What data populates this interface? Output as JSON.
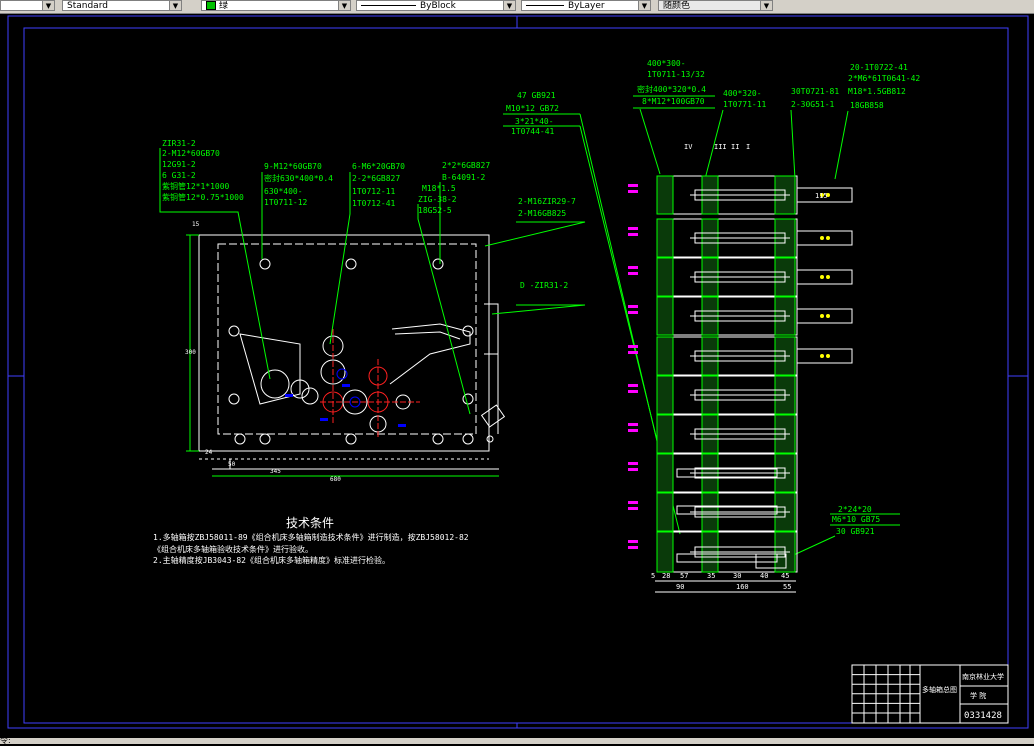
{
  "toolbar": {
    "textstyle": "Standard",
    "color": "绿",
    "linetype": "ByBlock",
    "lineweight": "ByLayer",
    "plotstyle": "随颜色"
  },
  "drawing": {
    "left_callouts": [
      "ZIR31-2",
      "2-M12*60GB70",
      "12G91-2",
      "6 G31-2",
      "紫铜管12*1*1000",
      "紫铜管12*0.75*1000"
    ],
    "mid_callouts_a": [
      "9-M12*60GB70",
      "密封630*400*0.4",
      "630*400-",
      "1T0711-12"
    ],
    "mid_callouts_b": [
      "6-M6*20GB70",
      "2-2*6GB827",
      "1T0712-11",
      "1T0712-41"
    ],
    "mid_callouts_c": [
      "2*2*6GB827",
      "B-64091-2"
    ],
    "mid_callouts_d": [
      "M18*1.5",
      "ZIG-38-2",
      "18G52-5"
    ],
    "right_of_box": [
      "2-M16ZIR29-7",
      "2-M16GB825"
    ],
    "d_label": "D -ZIR31-2",
    "top_center": [
      "47  GB921",
      "M10*12  GB72",
      "3*21*40-",
      "1T0744-41"
    ],
    "top_right_1": [
      "400*300-",
      "1T0711-13/32",
      "密封400*320*0.4",
      "8*M12*100GB70"
    ],
    "top_right_2": [
      "400*320-",
      "1T0771-11"
    ],
    "top_right_3": [
      "30T0721-81",
      "2-30G51-1"
    ],
    "top_right_4": [
      "20-1T0722-41",
      "2*M6*61T0641-42",
      "M18*1.5GB812",
      "18GB858"
    ],
    "bottom_right_callout": [
      "2*24*20",
      "M6*10  GB75",
      "30  GB921"
    ],
    "dims_left": [
      "50",
      "345",
      "680",
      "300",
      "24",
      "15"
    ],
    "dims_right": [
      "5",
      "28",
      "57",
      "35",
      "30",
      "40",
      "45",
      "90",
      "160",
      "55",
      "115"
    ],
    "roman": [
      "IV",
      "III",
      "II",
      "I"
    ],
    "tech_title": "技术条件",
    "tech_lines": [
      "1.多轴箱按ZBJ58011-89《组合机床多轴箱制造技术条件》进行制造，按ZBJ58012-82",
      "《组合机床多轴箱验收技术条件》进行验收。",
      "2.主轴精度按JB3043-82《组合机床多轴箱精度》标准进行检验。"
    ],
    "titleblock": {
      "name": "多轴箱总图",
      "school": "南京林业大学",
      "dept": "学 院",
      "number": "0331428"
    }
  },
  "colors": {
    "background": "#000000",
    "frame": "#4040ff",
    "cad_green": "#00ff00",
    "cad_white": "#ffffff",
    "cad_magenta": "#ff00ff",
    "cad_blue": "#0000ff",
    "cad_red": "#ff2020"
  },
  "status": {
    "prompt": "令:"
  }
}
